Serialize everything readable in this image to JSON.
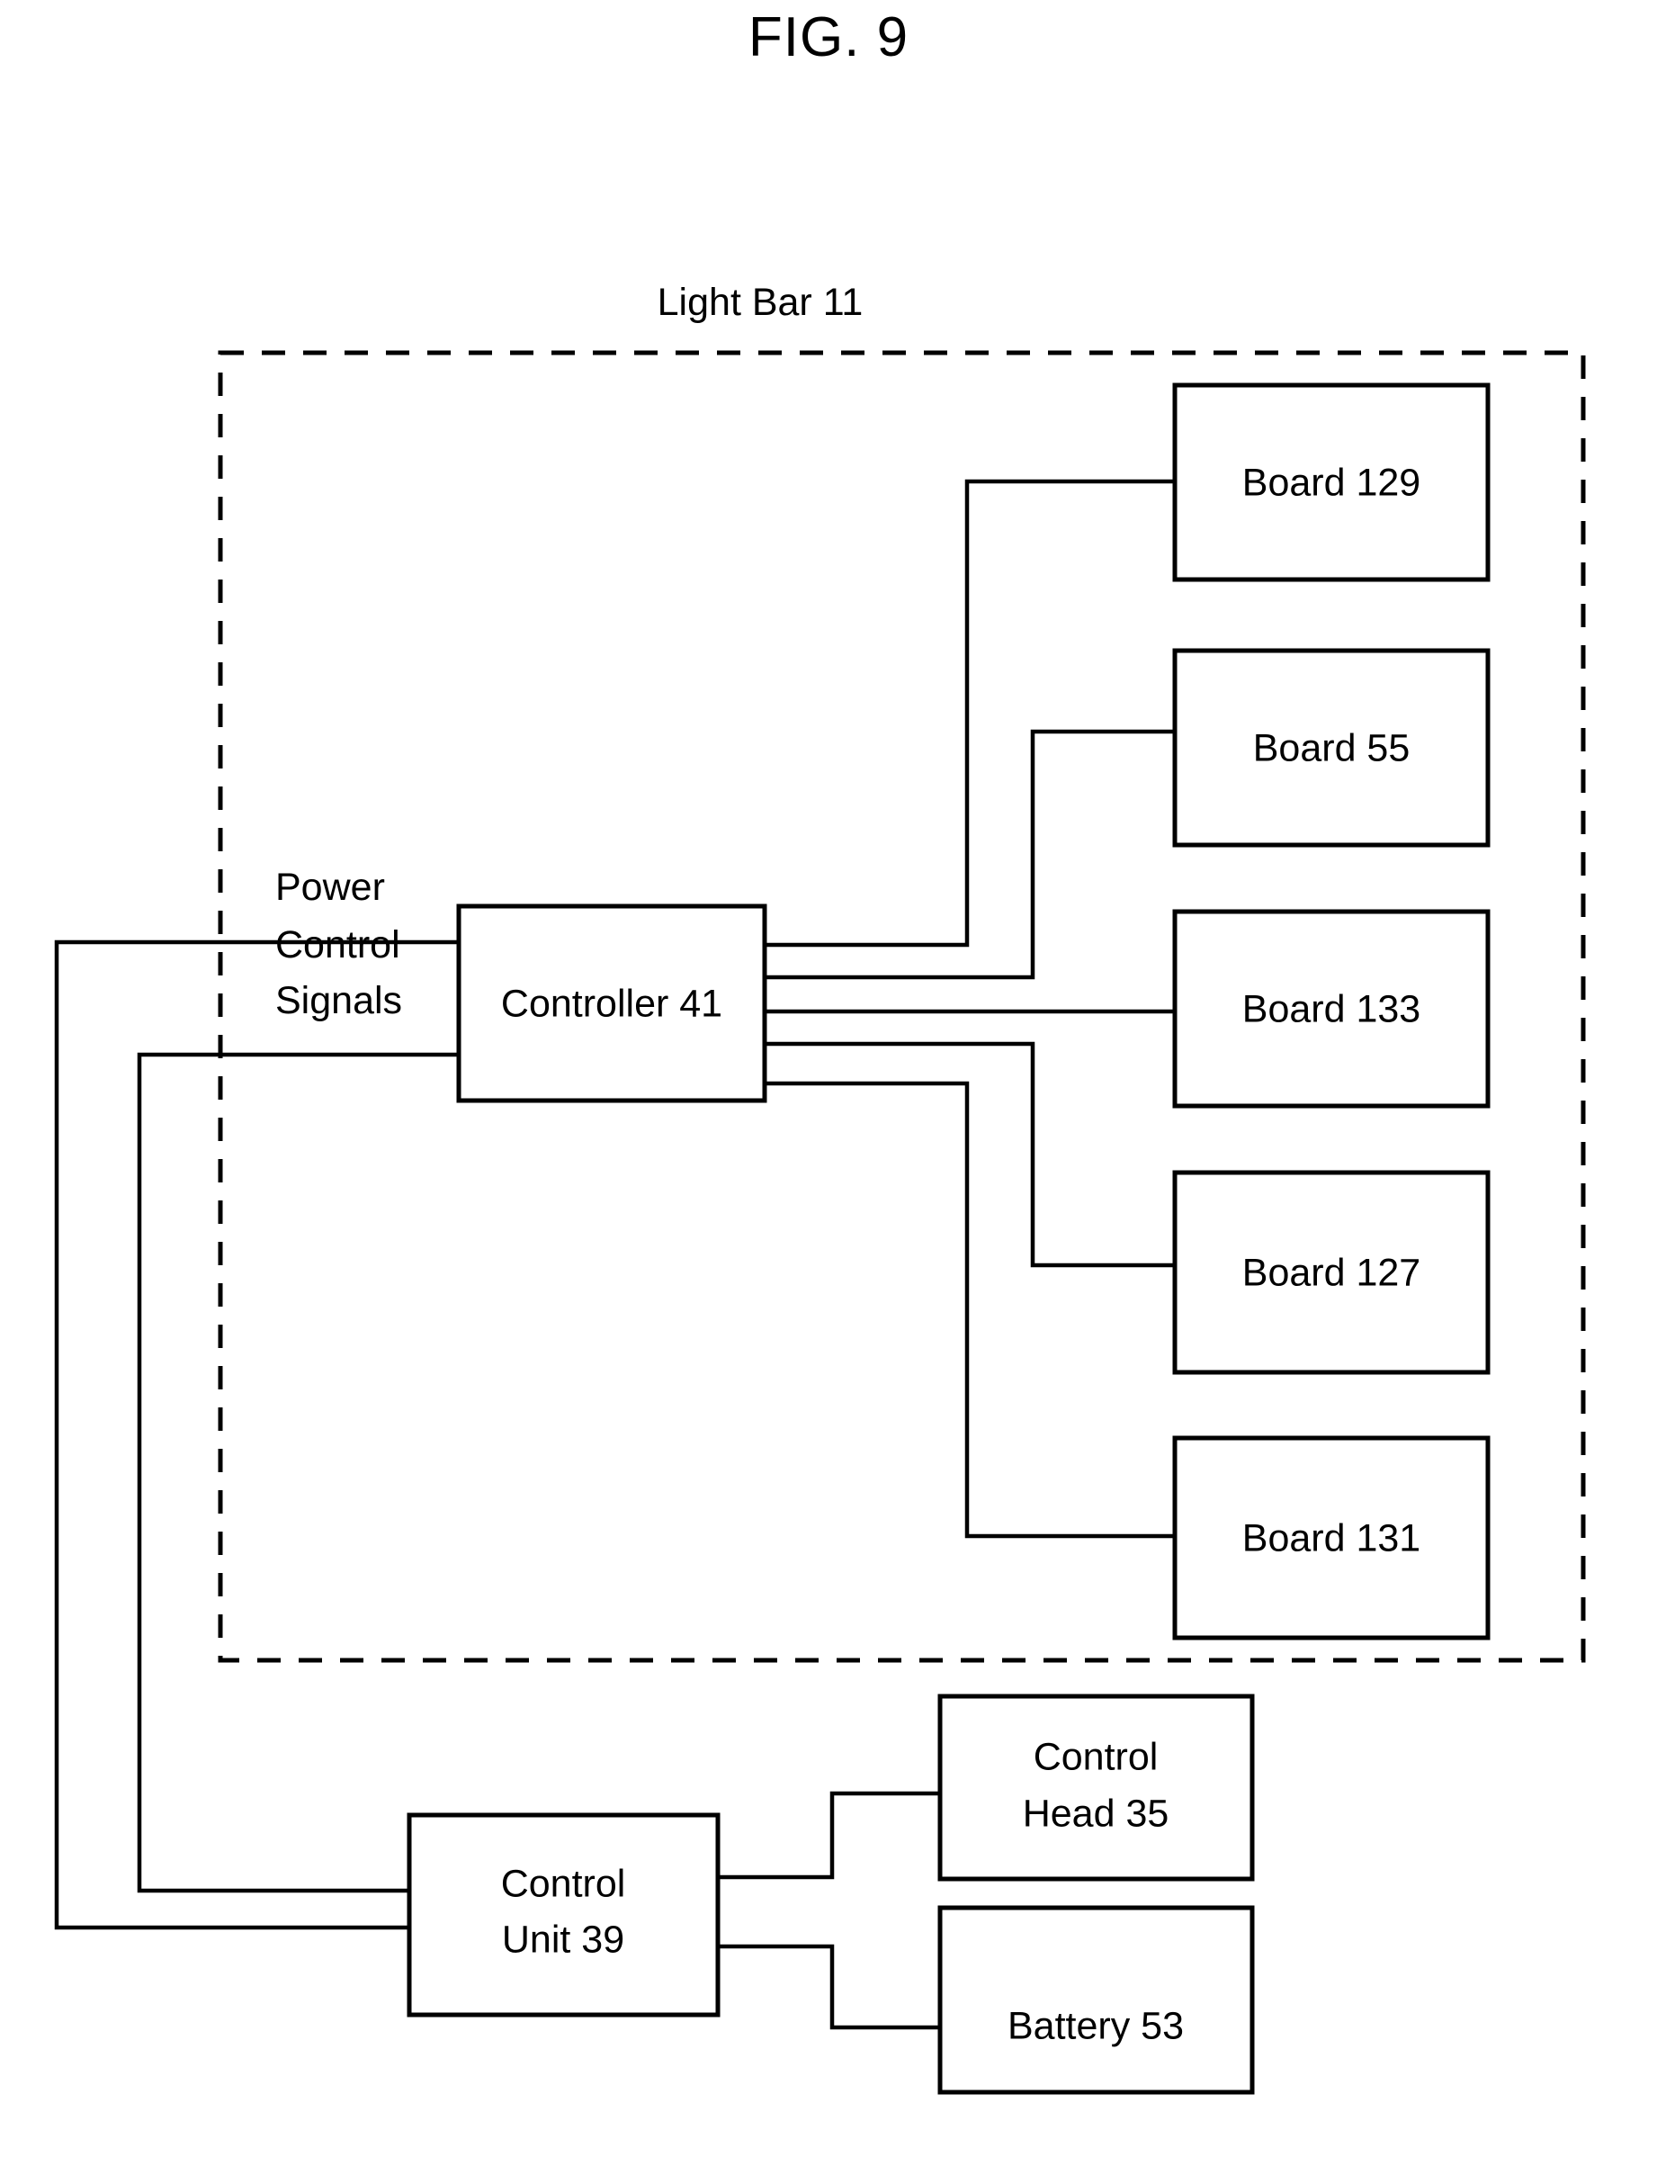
{
  "figure": {
    "title": "FIG. 9",
    "enclosure_label": "Light Bar 11"
  },
  "side_labels": {
    "power": "Power",
    "control": "Control",
    "signals": "Signals"
  },
  "blocks": {
    "controller": "Controller 41",
    "board_129": "Board 129",
    "board_55": "Board 55",
    "board_133": "Board 133",
    "board_127": "Board 127",
    "board_131": "Board 131",
    "control_unit_line1": "Control",
    "control_unit_line2": "Unit 39",
    "control_head_line1": "Control",
    "control_head_line2": "Head 35",
    "battery": "Battery 53"
  },
  "colors": {
    "line": "#000000",
    "background": "#ffffff",
    "text": "#000000"
  }
}
